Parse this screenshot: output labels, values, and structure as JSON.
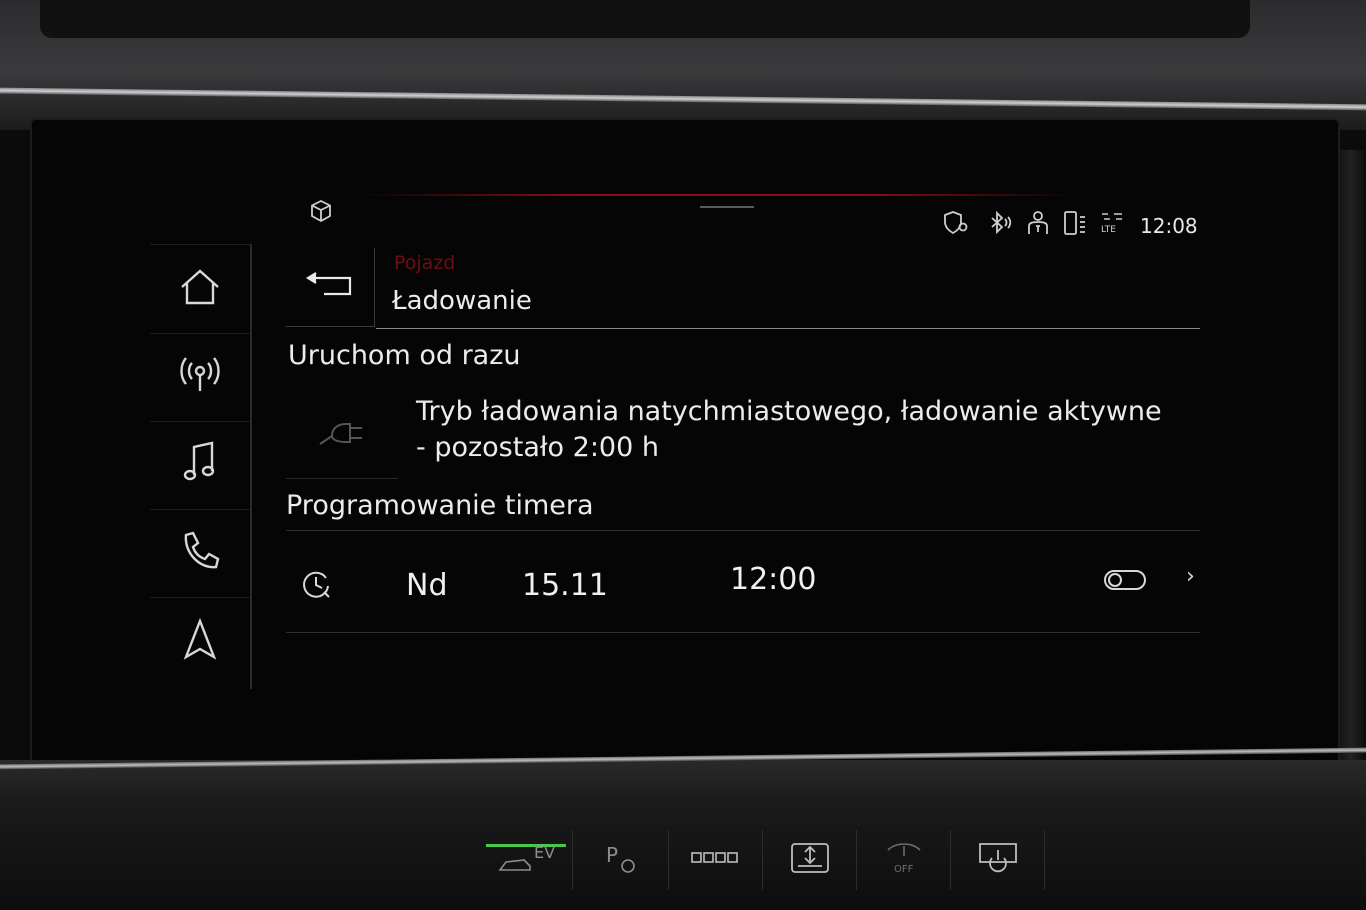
{
  "status_bar": {
    "time": "12:08",
    "icons": [
      "cube-icon",
      "shield-location-icon",
      "bluetooth-icon",
      "user-icon",
      "phone-signal-icon",
      "lte-icon"
    ],
    "lte_label": "LTE"
  },
  "nav": {
    "items": [
      {
        "icon": "home-icon"
      },
      {
        "icon": "radio-icon"
      },
      {
        "icon": "music-icon"
      },
      {
        "icon": "phone-icon"
      },
      {
        "icon": "navigation-icon"
      }
    ]
  },
  "header": {
    "breadcrumb": "Pojazd",
    "title": "Ładowanie"
  },
  "content": {
    "section1_title": "Uruchom od razu",
    "status_line1": "Tryb ładowania natychmiastowego, ładowanie aktywne",
    "status_line2": "- pozostało 2:00 h",
    "section2_title": "Programowanie timera",
    "timer": {
      "day": "Nd",
      "date": "15.11",
      "time": "12:00",
      "enabled": false
    }
  },
  "hardware_buttons": {
    "ev_label": "EV",
    "parking_label": "P",
    "off_label": "OFF"
  },
  "colors": {
    "accent_red": "#8c0d12",
    "ev_green": "#49c94a",
    "text": "#ececec",
    "background": "#050505"
  }
}
